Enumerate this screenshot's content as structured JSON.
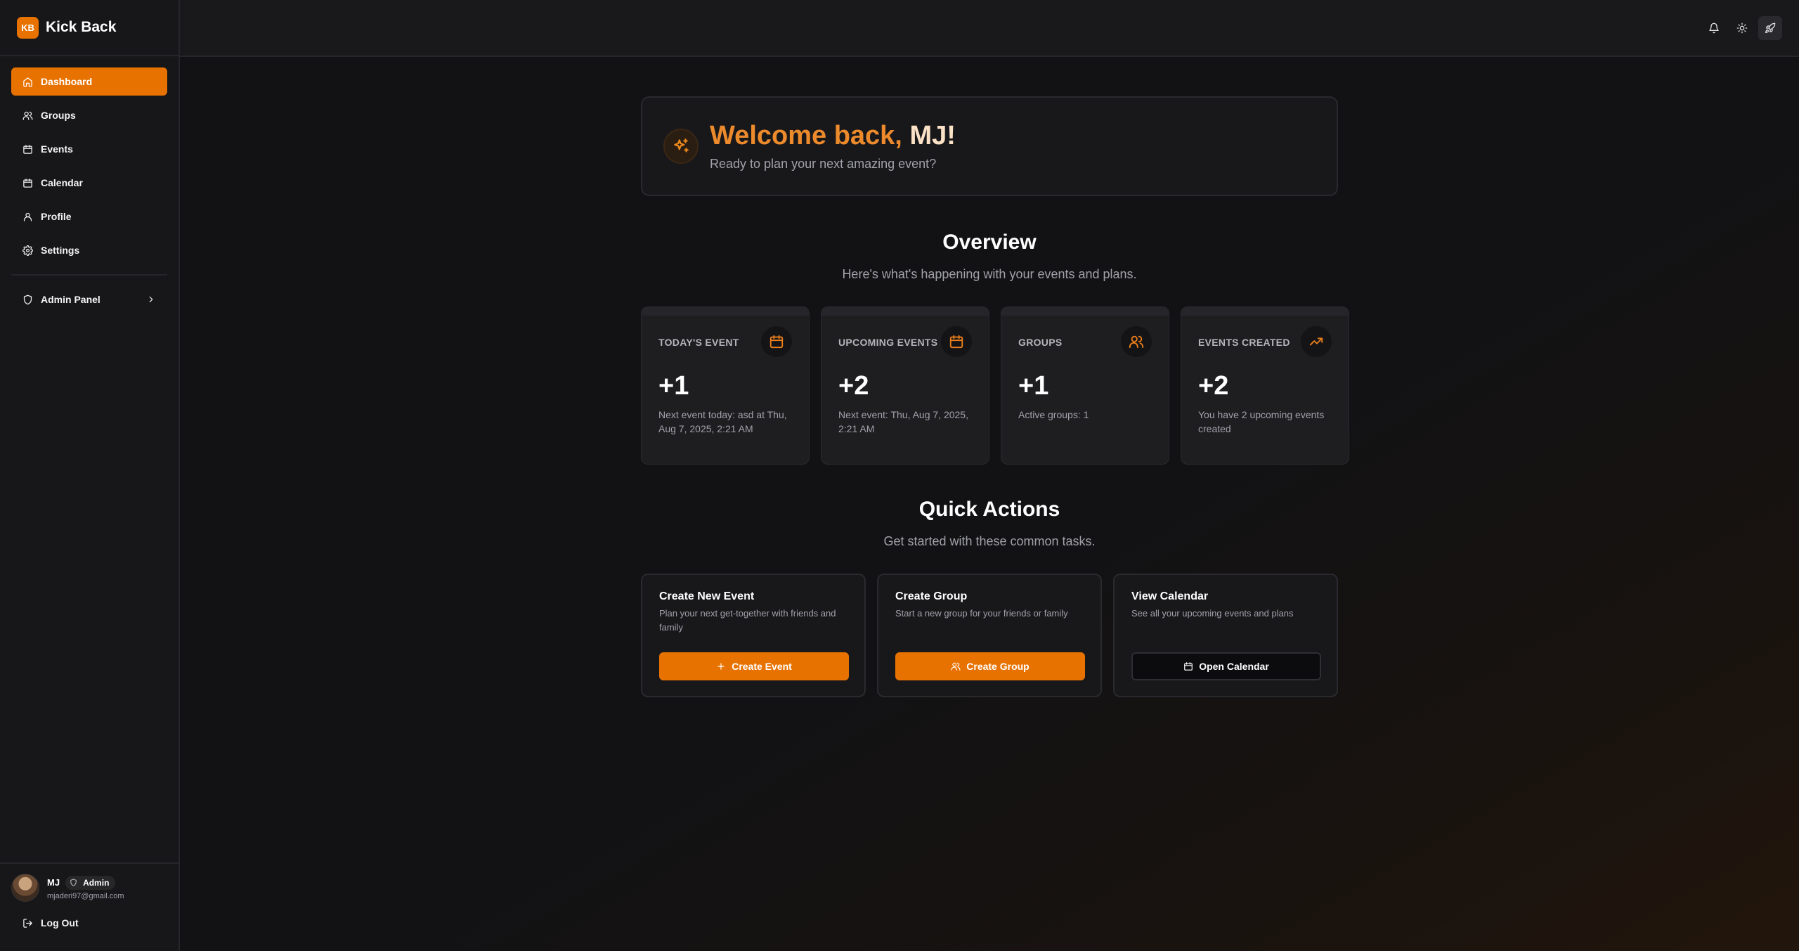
{
  "app": {
    "logo_text": "KB",
    "name": "Kick Back"
  },
  "sidebar": {
    "items": [
      {
        "label": "Dashboard",
        "icon": "home-icon"
      },
      {
        "label": "Groups",
        "icon": "users-icon"
      },
      {
        "label": "Events",
        "icon": "calendar-icon"
      },
      {
        "label": "Calendar",
        "icon": "calendar-icon"
      },
      {
        "label": "Profile",
        "icon": "user-icon"
      },
      {
        "label": "Settings",
        "icon": "gear-icon"
      }
    ],
    "admin": {
      "label": "Admin Panel",
      "icon": "shield-icon"
    },
    "user": {
      "name": "MJ",
      "role": "Admin",
      "email": "mjaderi97@gmail.com"
    },
    "logout_label": "Log Out"
  },
  "topbar": {
    "icons": [
      "bell-icon",
      "sun-icon",
      "rocket-icon"
    ]
  },
  "welcome": {
    "title_part1": "Welcome back,",
    "title_name": "MJ!",
    "subtitle": "Ready to plan your next amazing event?"
  },
  "overview": {
    "title": "Overview",
    "subtitle": "Here's what's happening with your events and plans.",
    "cards": [
      {
        "label": "TODAY'S EVENT",
        "value": "+1",
        "desc": "Next event today: asd at Thu, Aug 7, 2025, 2:21 AM",
        "icon": "calendar-icon"
      },
      {
        "label": "UPCOMING EVENTS",
        "value": "+2",
        "desc": "Next event: Thu, Aug 7, 2025, 2:21 AM",
        "icon": "calendar-icon"
      },
      {
        "label": "GROUPS",
        "value": "+1",
        "desc": "Active groups: 1",
        "icon": "users-icon"
      },
      {
        "label": "EVENTS CREATED",
        "value": "+2",
        "desc": "You have 2 upcoming events created",
        "icon": "trending-up-icon"
      }
    ]
  },
  "quick_actions": {
    "title": "Quick Actions",
    "subtitle": "Get started with these common tasks.",
    "cards": [
      {
        "title": "Create New Event",
        "desc": "Plan your next get-together with friends and family",
        "button": "Create Event",
        "icon": "plus-icon"
      },
      {
        "title": "Create Group",
        "desc": "Start a new group for your friends or family",
        "button": "Create Group",
        "icon": "users-icon"
      },
      {
        "title": "View Calendar",
        "desc": "See all your upcoming events and plans",
        "button": "Open Calendar",
        "icon": "calendar-icon"
      }
    ]
  },
  "colors": {
    "accent": "#e87200",
    "background": "#121214",
    "sidebar": "#17171a"
  }
}
